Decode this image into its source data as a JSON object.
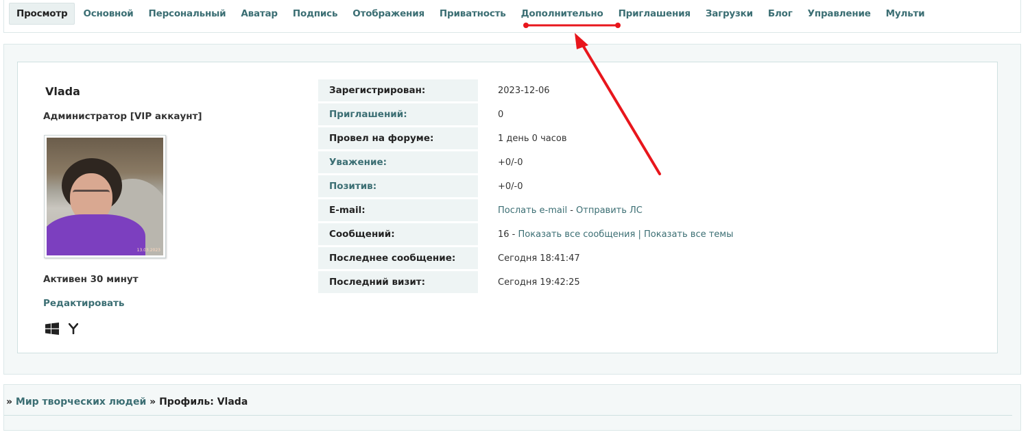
{
  "tabs": [
    {
      "label": "Просмотр",
      "active": true
    },
    {
      "label": "Основной"
    },
    {
      "label": "Персональный"
    },
    {
      "label": "Аватар"
    },
    {
      "label": "Подпись"
    },
    {
      "label": "Отображения"
    },
    {
      "label": "Приватность"
    },
    {
      "label": "Дополнительно"
    },
    {
      "label": "Приглашения"
    },
    {
      "label": "Загрузки"
    },
    {
      "label": "Блог"
    },
    {
      "label": "Управление"
    },
    {
      "label": "Мульти"
    }
  ],
  "profile": {
    "username": "Vlada",
    "title": "Администратор [VIP аккаунт]",
    "active": "Активен 30 минут",
    "edit": "Редактировать",
    "avatar_caption": "13.03.2023",
    "os_icons": [
      "windows-icon",
      "yandex-browser-icon"
    ]
  },
  "info": {
    "registered": {
      "label": "Зарегистрирован:",
      "value": "2023-12-06"
    },
    "invites": {
      "label": "Приглашений:",
      "value": "0"
    },
    "time_on_forum": {
      "label": "Провел на форуме:",
      "value": "1 день 0 часов"
    },
    "respect": {
      "label": "Уважение:",
      "value": "+0/-0"
    },
    "positive": {
      "label": "Позитив:",
      "value": "+0/-0"
    },
    "email": {
      "label": "E-mail:",
      "send_email": "Послать e-mail",
      "sep": " - ",
      "send_pm": "Отправить ЛС"
    },
    "posts": {
      "label": "Сообщений:",
      "count": "16",
      "sep": " - ",
      "show_posts": "Показать все сообщения",
      "sep2": " | ",
      "show_topics": "Показать все темы"
    },
    "last_post": {
      "label": "Последнее сообщение:",
      "value": "Сегодня 18:41:47"
    },
    "last_visit": {
      "label": "Последний визит:",
      "value": "Сегодня 19:42:25"
    }
  },
  "breadcrumb": {
    "prefix": "» ",
    "forum": "Мир творческих людей",
    "sep": " » ",
    "current": "Профиль: Vlada"
  },
  "colors": {
    "link": "#3b6e73",
    "annotation": "#e8161c"
  }
}
